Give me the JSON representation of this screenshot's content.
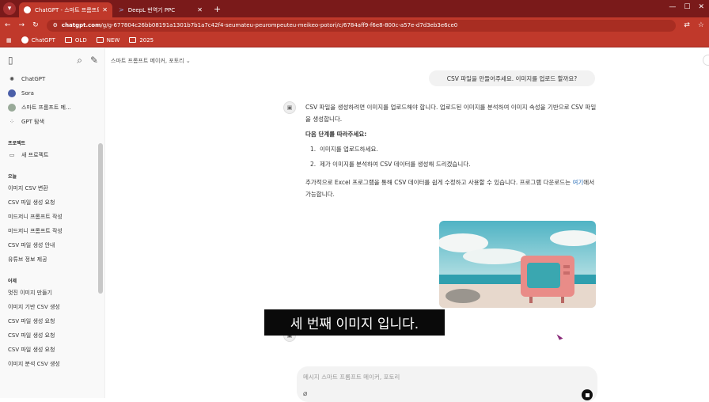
{
  "browser": {
    "tabs": [
      {
        "label": "ChatGPT - 스마트 프롬프트 메",
        "active": true,
        "favicon": "chatgpt-icon"
      },
      {
        "label": "DeepL 번역기 PPC",
        "active": false,
        "favicon": "deepl-icon"
      }
    ],
    "url_host": "chatgpt.com",
    "url_path": "/g/g-677804c26bb08191a1301b7b1a7c42f4-seumateu-peurompeuteu-meikeo-potori/c/6784aff9-f6e8-800c-a57e-d7d3eb3e6ce0",
    "bookmarks": [
      "ChatGPT",
      "OLD",
      "NEW",
      "2025"
    ]
  },
  "sidebar": {
    "main_items": [
      {
        "label": "ChatGPT",
        "icon": "chatgpt-icon"
      },
      {
        "label": "Sora",
        "icon": "sora-icon"
      },
      {
        "label": "스마트 프롬프트 메...",
        "icon": "gpt-avatar-icon"
      },
      {
        "label": "GPT 탐색",
        "icon": "grid-icon"
      }
    ],
    "project_section": "프로젝트",
    "new_project": "새 프로젝트",
    "today_section": "오늘",
    "today_items": [
      "이미지 CSV 변환",
      "CSV 파일 생성 요청",
      "미드저니 프롬프트 작성",
      "미드저니 프롬프트 작성",
      "CSV 파일 생성 안내",
      "유튜브 정보 제공"
    ],
    "yesterday_section": "어제",
    "yesterday_items": [
      "멋진 이미지 만들기",
      "이미지 기반 CSV 생성",
      "CSV 파일 생성 요청",
      "CSV 파일 생성 요청",
      "CSV 파일 생성 요청",
      "이미지 분석 CSV 생성"
    ]
  },
  "main": {
    "model_name": "스마트 프롬프트 메이커, 포토리",
    "user_message": "CSV 파일을 만들어주세요. 이미지를 업로드 할까요?",
    "answer_p1": "CSV 파일을 생성하려면 이미지를 업로드해야 합니다. 업로드된 이미지를 분석하여 이미지 속성을 기반으로 CSV 파일을 생성합니다.",
    "answer_heading": "다음 단계를 따라주세요:",
    "steps": [
      {
        "n": "1.",
        "text": "이미지를 업로드하세요."
      },
      {
        "n": "2.",
        "text": "제가 이미지를 분석하여 CSV 데이터를 생성해 드리겠습니다."
      }
    ],
    "answer_p2_before": "추가적으로 Excel 프로그램을 통해 CSV 데이터를 쉽게 수정하고 사용할 수 있습니다. 프로그램 다운로드는 ",
    "answer_link": "여기",
    "answer_p2_after": "에서 가능합니다.",
    "subtitle": "세 번째 이미지 입니다.",
    "composer_placeholder": "메시지 스마트 프롬프트 메이커, 포토리"
  }
}
